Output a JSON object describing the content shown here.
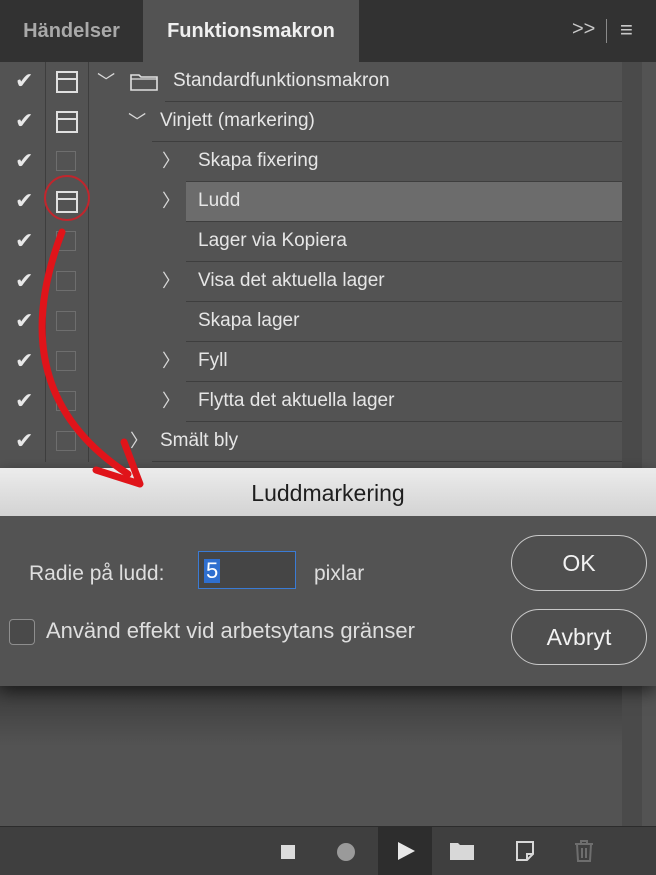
{
  "tabs": [
    {
      "label": "Händelser"
    },
    {
      "label": "Funktionsmakron"
    }
  ],
  "tab_menu": {
    "expand": ">>",
    "menu": "≡"
  },
  "actions": {
    "check_glyph": "✔",
    "rows": [
      {
        "label": "Standardfunktionsmakron",
        "type": "set"
      },
      {
        "label": "Vinjett (markering)",
        "type": "action"
      },
      {
        "label": "Skapa fixering",
        "type": "step"
      },
      {
        "label": "Ludd",
        "type": "step",
        "selected": true
      },
      {
        "label": "Lager via Kopiera",
        "type": "step"
      },
      {
        "label": "Visa det aktuella lager",
        "type": "step"
      },
      {
        "label": "Skapa lager",
        "type": "step"
      },
      {
        "label": "Fyll",
        "type": "step"
      },
      {
        "label": "Flytta det aktuella lager",
        "type": "step"
      },
      {
        "label": "Smält bly",
        "type": "action"
      }
    ]
  },
  "dialog": {
    "title": "Luddmarkering",
    "radius_label": "Radie på ludd:",
    "radius_value": "5",
    "radius_unit": "pixlar",
    "checkbox_label": "Använd effekt vid arbetsytans gränser",
    "checkbox_checked": false,
    "ok_label": "OK",
    "cancel_label": "Avbryt"
  },
  "colors": {
    "panel_bg": "#535353",
    "selection": "#6c6c6c",
    "annotation_red": "#e0141a",
    "input_focus": "#3a7bd5"
  }
}
